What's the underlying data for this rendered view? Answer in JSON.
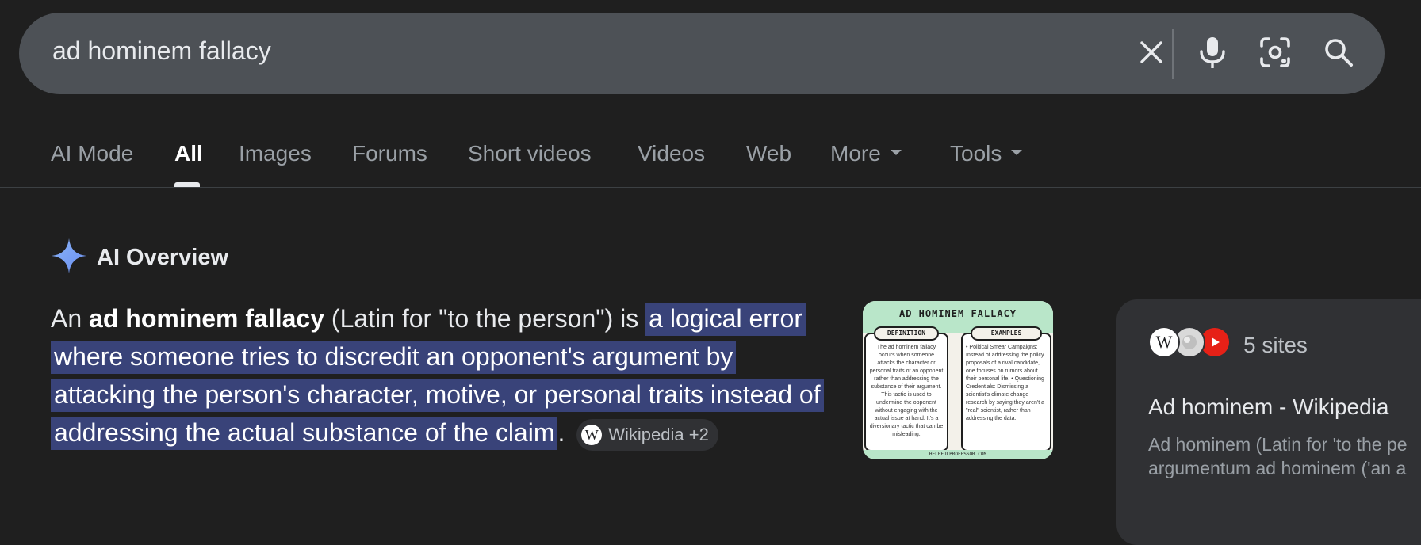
{
  "search": {
    "query": "ad hominem fallacy"
  },
  "search_icons": [
    "close-icon",
    "microphone-icon",
    "lens-icon",
    "search-icon"
  ],
  "tabs": [
    {
      "label": "AI Mode"
    },
    {
      "label": "All"
    },
    {
      "label": "Images"
    },
    {
      "label": "Forums"
    },
    {
      "label": "Short videos"
    },
    {
      "label": "Videos"
    },
    {
      "label": "Web"
    },
    {
      "label": "More"
    },
    {
      "label": "Tools"
    }
  ],
  "ai_overview": {
    "title": "AI Overview",
    "text_parts": {
      "p1": "An ",
      "bold": "ad hominem fallacy",
      "p2": " (Latin for \"to the person\") is ",
      "highlight": "a logical error where someone tries to discredit an opponent's argument by attacking the person's character, motive, or personal traits instead of addressing the actual substance of the claim",
      "p3": "."
    },
    "citation": "Wikipedia +2",
    "thumbnail": {
      "title": "AD HOMINEM FALLACY",
      "left_label": "DEFINITION",
      "left_body": "The ad hominem fallacy occurs when someone attacks the character or personal traits of an opponent rather than addressing the substance of their argument. This tactic is used to undermine the opponent without engaging with the actual issue at hand. It's a diversionary tactic that can be misleading.",
      "right_label": "EXAMPLES",
      "right_body": "• Political Smear Campaigns: Instead of addressing the policy proposals of a rival candidate, one focuses on rumors about their personal life. • Questioning Credentials: Dismissing a scientist's climate change research by saying they aren't a \"real\" scientist, rather than addressing the data.",
      "footer": "HELPFULPROFESSOR.COM"
    }
  },
  "sources": {
    "count_label": "5 sites",
    "title": "Ad hominem - Wikipedia",
    "snippet_line1": "Ad hominem (Latin for 'to the pe",
    "snippet_line2": "argumentum ad hominem ('an a"
  },
  "colors": {
    "background": "#1f1f1f",
    "searchbar": "#4d5156",
    "highlight": "#394379",
    "ai_sparkle": "#7ba2f5",
    "youtube_red": "#e62117"
  }
}
